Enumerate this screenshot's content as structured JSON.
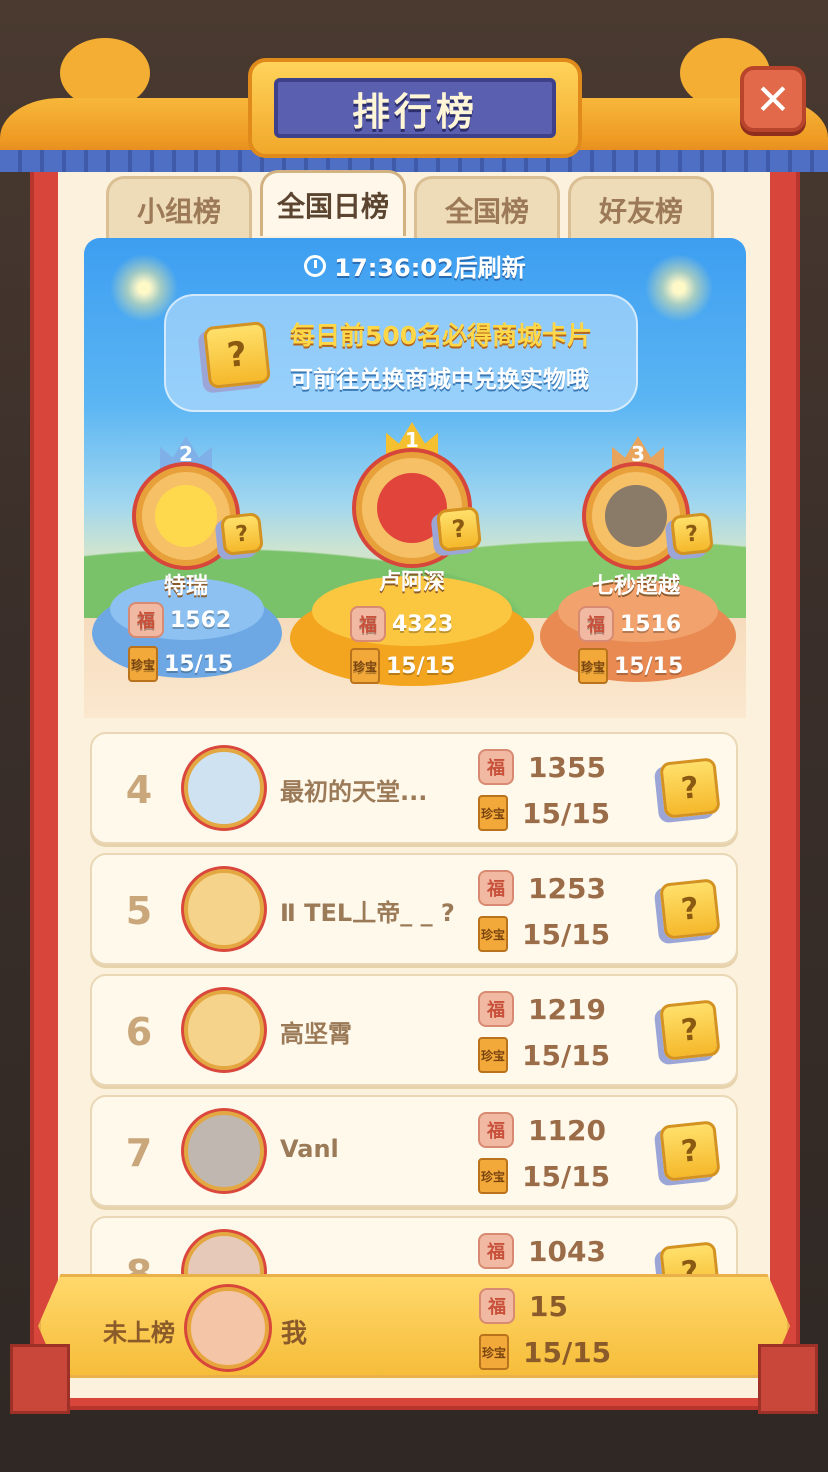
{
  "header": {
    "title": "排行榜",
    "close_label": "✕"
  },
  "tabs": [
    {
      "label": "小组榜",
      "active": false
    },
    {
      "label": "全国日榜",
      "active": true
    },
    {
      "label": "全国榜",
      "active": false
    },
    {
      "label": "好友榜",
      "active": false
    }
  ],
  "refresh": {
    "text": "17:36:02后刷新"
  },
  "banner": {
    "line1": "每日前500名必得商城卡片",
    "line2": "可前往兑换商城中兑换实物哦",
    "card_icon_glyph": "?"
  },
  "podium": {
    "first": {
      "rank": "1",
      "name": "卢阿深",
      "score": "4323",
      "progress": "15/15"
    },
    "second": {
      "rank": "2",
      "name": "特瑞",
      "score": "1562",
      "progress": "15/15"
    },
    "third": {
      "rank": "3",
      "name": "七秒超越",
      "score": "1516",
      "progress": "15/15"
    }
  },
  "icons": {
    "fu": "福",
    "book": "珍宝"
  },
  "list": [
    {
      "rank": "4",
      "name": "最初的天堂...",
      "score": "1355",
      "progress": "15/15"
    },
    {
      "rank": "5",
      "name": "Ⅱ TEL丄帝_ _ ?",
      "score": "1253",
      "progress": "15/15"
    },
    {
      "rank": "6",
      "name": "高坚霄",
      "score": "1219",
      "progress": "15/15"
    },
    {
      "rank": "7",
      "name": "Vanl",
      "score": "1120",
      "progress": "15/15"
    },
    {
      "rank": "8",
      "name": "",
      "score": "1043",
      "progress": ""
    }
  ],
  "me": {
    "rank_label": "未上榜",
    "name": "我",
    "score": "15",
    "progress": "15/15"
  },
  "colors": {
    "frame_red": "#d8453a",
    "panel_cream": "#fbf1dc",
    "gold": "#f6bd3a",
    "podium_first": "#f7b52e",
    "podium_second": "#7fb7ec",
    "podium_third": "#f0a066"
  }
}
